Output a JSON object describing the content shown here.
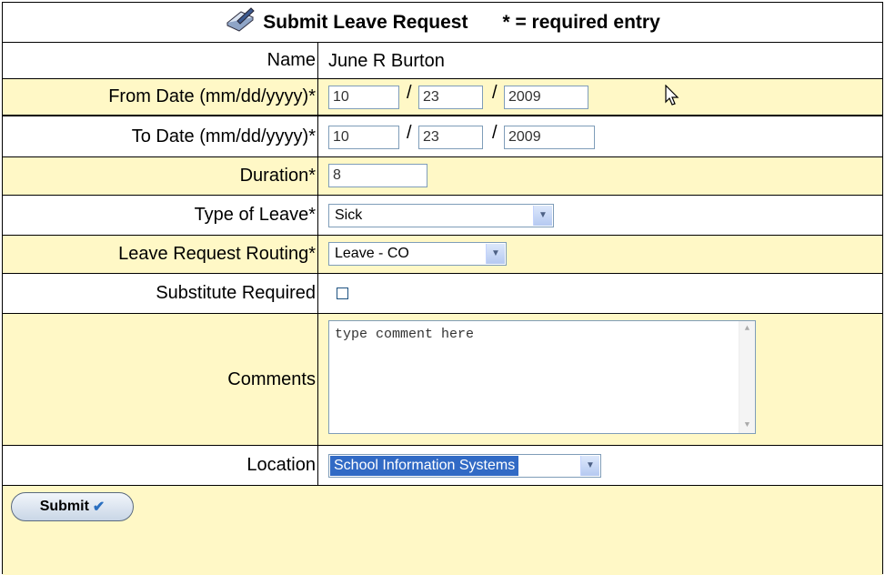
{
  "form": {
    "title": "Submit Leave Request",
    "required_note": "* = required entry",
    "icon": "pen-paper-icon"
  },
  "fields": {
    "name": {
      "label": "Name",
      "value": "June R Burton"
    },
    "from_date": {
      "label": "From Date (mm/dd/yyyy)*",
      "month": "10",
      "day": "23",
      "year": "2009",
      "sep": "/"
    },
    "to_date": {
      "label": "To Date (mm/dd/yyyy)*",
      "month": "10",
      "day": "23",
      "year": "2009",
      "sep": "/"
    },
    "duration": {
      "label": "Duration*",
      "value": "8"
    },
    "leave_type": {
      "label": "Type of Leave*",
      "selected": "Sick"
    },
    "routing": {
      "label": "Leave Request Routing*",
      "selected": "Leave - CO"
    },
    "substitute": {
      "label": "Substitute Required",
      "checked": false
    },
    "comments": {
      "label": "Comments",
      "placeholder": "type comment here"
    },
    "location": {
      "label": "Location",
      "selected": "School Information Systems"
    }
  },
  "actions": {
    "submit_label": "Submit"
  },
  "colors": {
    "highlight_row": "#fff8c6",
    "selection": "#316ac5",
    "input_border": "#7f9db9"
  }
}
